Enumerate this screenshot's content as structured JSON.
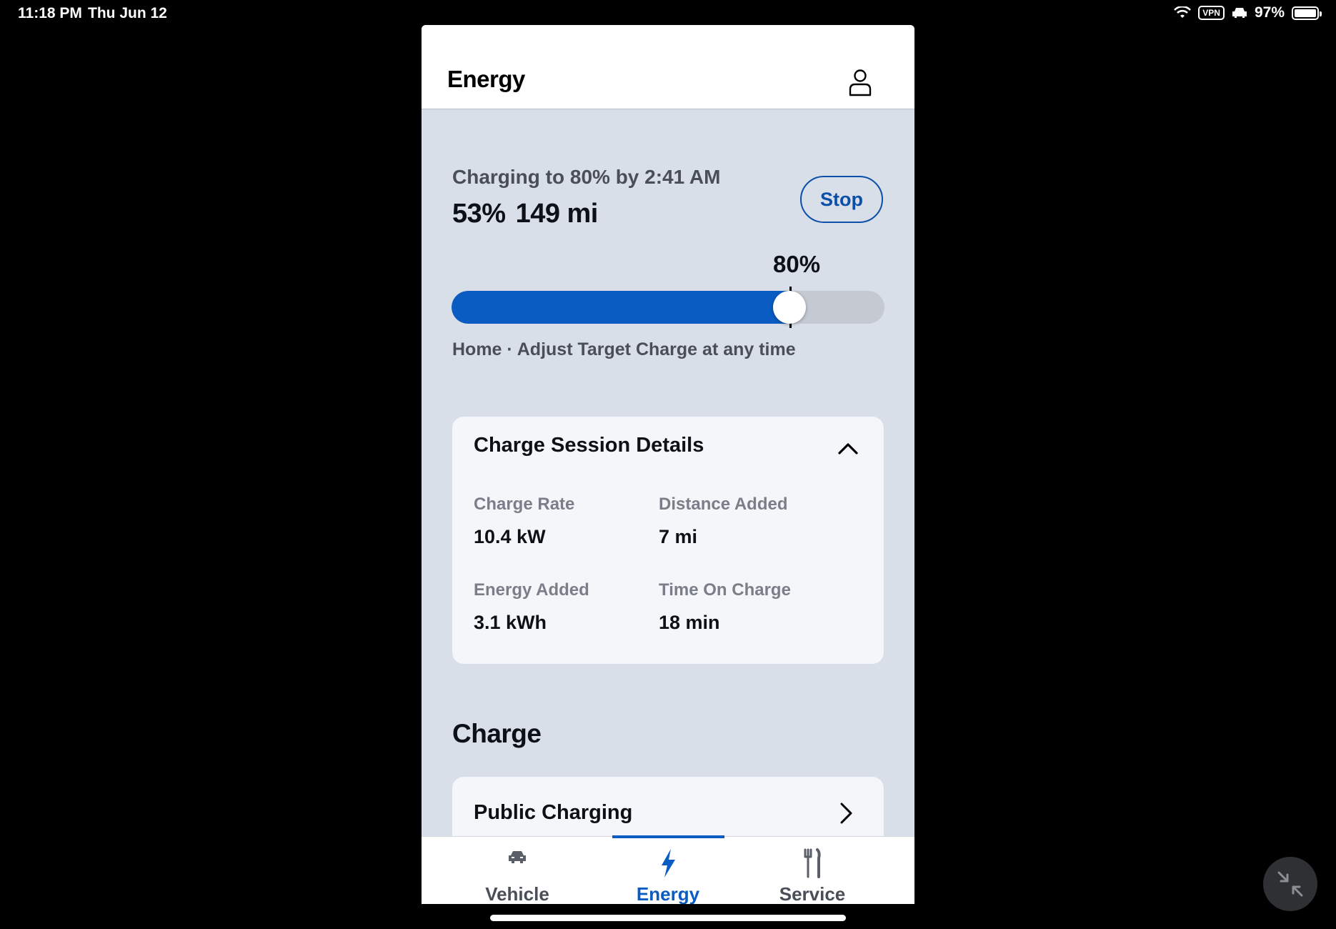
{
  "status_bar": {
    "time": "11:18 PM",
    "date": "Thu Jun 12",
    "vpn_label": "VPN",
    "battery_percent": "97%",
    "battery_level": 0.97
  },
  "header": {
    "title": "Energy",
    "profile_icon": "person-icon"
  },
  "charge_status": {
    "charging_text": "Charging to 80% by 2:41 AM",
    "current_percent": "53%",
    "range": "149 mi",
    "stop_label": "Stop",
    "target_label": "80%",
    "current_level": 0.53,
    "target_level": 0.8,
    "location_note": "Home · Adjust Target Charge at any time"
  },
  "session_details": {
    "title": "Charge Session Details",
    "expanded": true,
    "items": [
      {
        "label": "Charge Rate",
        "value": "10.4 kW"
      },
      {
        "label": "Distance Added",
        "value": "7 mi"
      },
      {
        "label": "Energy Added",
        "value": "3.1 kWh"
      },
      {
        "label": "Time On Charge",
        "value": "18 min"
      }
    ]
  },
  "charge_section": {
    "heading": "Charge",
    "public_charging_label": "Public Charging"
  },
  "bottom_nav": {
    "items": [
      {
        "label": "Vehicle",
        "icon": "car-icon",
        "active": false
      },
      {
        "label": "Energy",
        "icon": "lightning-icon",
        "active": true
      },
      {
        "label": "Service",
        "icon": "tools-icon",
        "active": false
      }
    ]
  },
  "colors": {
    "accent": "#0a5cc2",
    "background": "#d9dfe9",
    "card": "#f5f6f9"
  }
}
